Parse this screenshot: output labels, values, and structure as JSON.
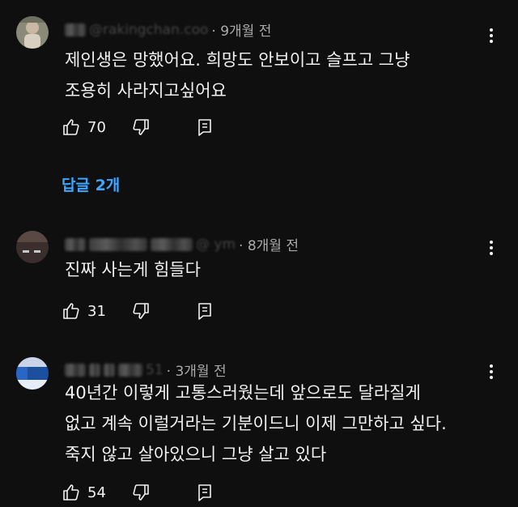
{
  "colors": {
    "background": "#0f0f0f",
    "text": "#f1f1f1",
    "meta": "#aaaaaa",
    "link": "#3ea6ff"
  },
  "comments": [
    {
      "handle": "@rakingchan.coo",
      "time": "· 9개월 전",
      "lines": [
        "제인생은 망했어요. 희망도 안보이고 슬프고 그냥",
        "조용히 사라지고싶어요"
      ],
      "likes": "70",
      "replies_label": "답글 2개"
    },
    {
      "handle": "@ ym",
      "time": "· 8개월 전",
      "lines": [
        "진짜 사는게 힘들다"
      ],
      "likes": "31"
    },
    {
      "handle": "51",
      "time": "· 3개월 전",
      "lines": [
        "40년간 이렇게 고통스러웠는데 앞으로도 달라질게",
        "없고 계속 이럴거라는 기분이드니 이제 그만하고 싶다.",
        "죽지 않고 살아있으니 그냥 살고 있다"
      ],
      "likes": "54"
    }
  ],
  "icons": {
    "like": "thumbs-up-icon",
    "dislike": "thumbs-down-icon",
    "reply": "reply-icon",
    "menu": "more-vert-icon"
  }
}
